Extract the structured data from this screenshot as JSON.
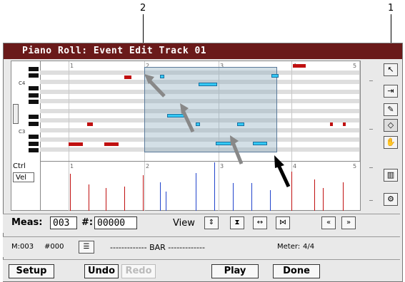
{
  "callouts": {
    "left": "2",
    "right": "1"
  },
  "window": {
    "title": "Piano Roll: Event Edit Track 01"
  },
  "roll": {
    "measures": [
      "1",
      "2",
      "3",
      "4",
      "5"
    ],
    "octave_labels": [
      "C4",
      "C3"
    ],
    "ctrl_label": "Ctrl",
    "ctrl_value": "Vel"
  },
  "meas": {
    "label": "Meas:",
    "value": "003",
    "hash_label": "#:",
    "hash_value": "00000"
  },
  "view": {
    "label": "View"
  },
  "status": {
    "meas": "M:003",
    "hash": "#000",
    "bar": "------------- BAR -------------",
    "meter_label": "Meter:",
    "meter_value": "4/4"
  },
  "buttons": {
    "setup": "Setup",
    "undo": "Undo",
    "redo": "Redo",
    "play": "Play",
    "done": "Done"
  },
  "colors": {
    "title_bar": "#6a1a1a",
    "note_unselected": "#c01010",
    "note_selected": "#33c8f4",
    "vel_unselected": "#c01010",
    "vel_selected": "#2244cc"
  }
}
